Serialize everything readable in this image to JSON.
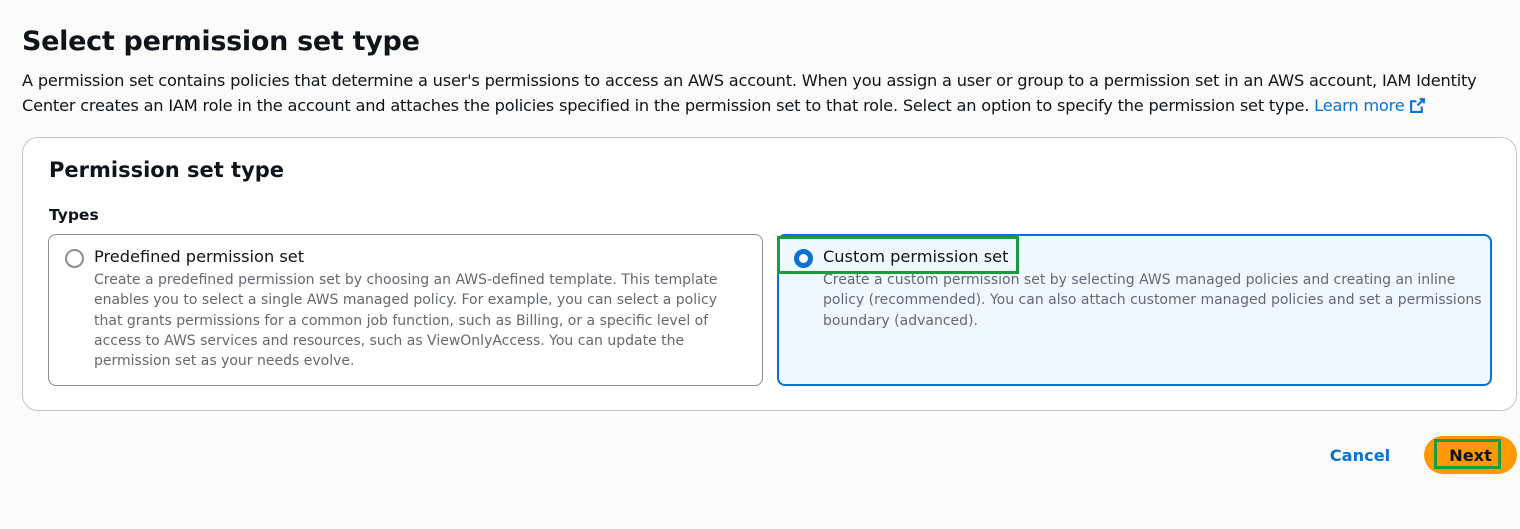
{
  "page": {
    "title": "Select permission set type",
    "description": "A permission set contains policies that determine a user's permissions to access an AWS account. When you assign a user or group to a permission set in an AWS account, IAM Identity Center creates an IAM role in the account and attaches the policies specified in the permission set to that role. Select an option to specify the permission set type.",
    "learn_more": "Learn more"
  },
  "panel": {
    "title": "Permission set type",
    "types_label": "Types",
    "options": [
      {
        "label": "Predefined permission set",
        "description": "Create a predefined permission set by choosing an AWS-defined template. This template enables you to select a single AWS managed policy. For example, you can select a policy that grants permissions for a common job function, such as Billing, or a specific level of access to AWS services and resources, such as ViewOnlyAccess. You can update the permission set as your needs evolve.",
        "selected": false
      },
      {
        "label": "Custom permission set",
        "description": "Create a custom permission set by selecting AWS managed policies and creating an inline policy (recommended). You can also attach customer managed policies and set a permissions boundary (advanced).",
        "selected": true
      }
    ]
  },
  "actions": {
    "cancel_label": "Cancel",
    "next_label": "Next"
  },
  "colors": {
    "accent": "#0972d3",
    "primary_button": "#ff9900",
    "highlight": "#1d9c3f",
    "selected_tile_bg": "#f0f8ff"
  },
  "icons": {
    "learn_more": "external-link-icon"
  }
}
